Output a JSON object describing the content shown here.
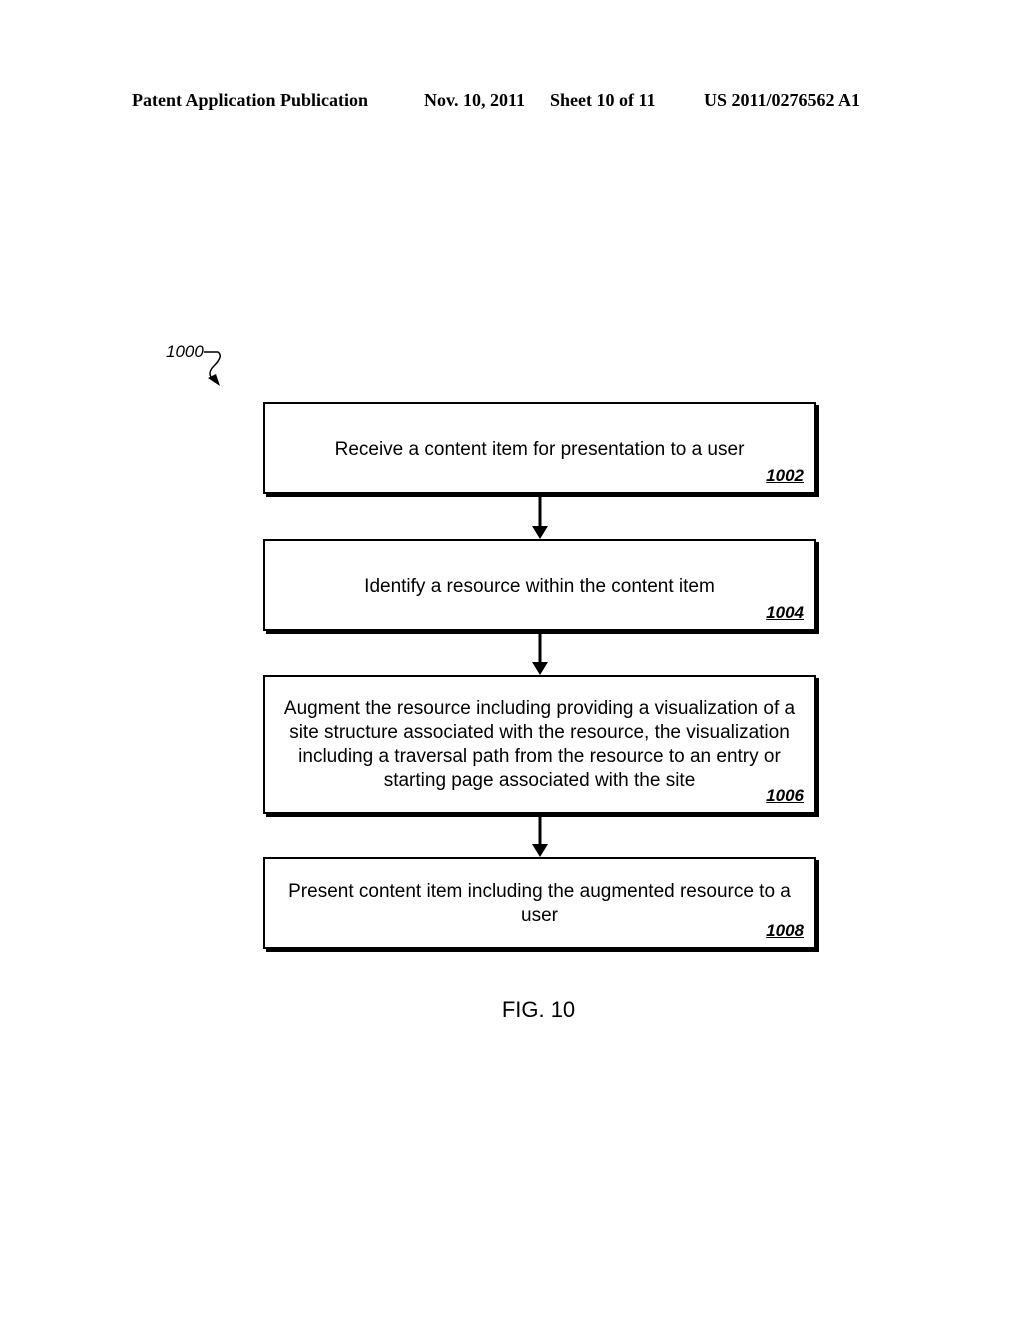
{
  "header": {
    "publication": "Patent Application Publication",
    "date": "Nov. 10, 2011",
    "sheet": "Sheet 10 of 11",
    "number": "US 2011/0276562 A1"
  },
  "diagram": {
    "reference": "1000",
    "steps": [
      {
        "text": "Receive a content item for presentation to a user",
        "id": "1002"
      },
      {
        "text": "Identify a resource within the content item",
        "id": "1004"
      },
      {
        "text": "Augment the resource including providing a visualization of a site structure associated with the resource, the visualization including a traversal path from the resource to an entry or starting page associated with the site",
        "id": "1006"
      },
      {
        "text": "Present content item including the augmented resource to a user",
        "id": "1008"
      }
    ],
    "caption": "FIG. 10"
  }
}
